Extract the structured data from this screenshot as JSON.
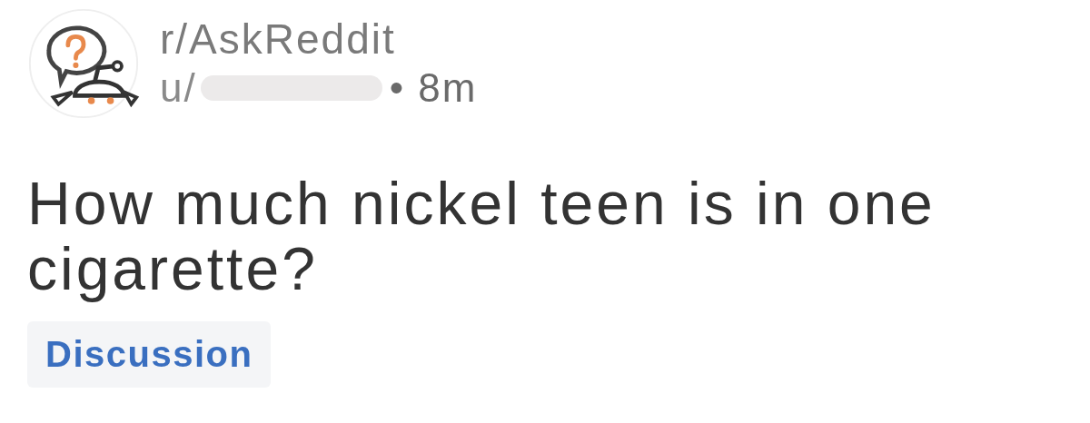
{
  "post": {
    "subreddit": "r/AskReddit",
    "author": "u/",
    "time": "• 8m",
    "title": "How much nickel teen is in one cigarette?",
    "flair": "Discussion"
  }
}
